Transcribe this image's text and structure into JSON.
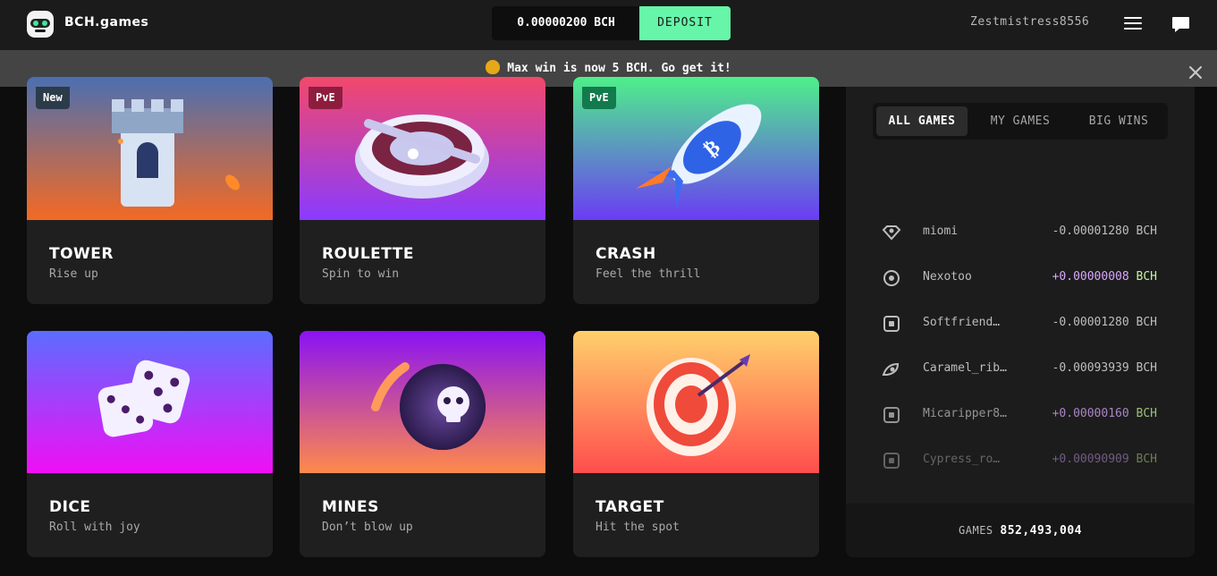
{
  "header": {
    "brand": "BCH.games",
    "balance": "0.00000200 BCH",
    "deposit_label": "DEPOSIT",
    "username": "Zestmistress8556"
  },
  "announcement": {
    "text": "Max win is now 5 BCH. Go get it!"
  },
  "games": [
    {
      "title": "TOWER",
      "subtitle": "Rise up",
      "badge": "New",
      "badge_color": "#2c3b4a",
      "gradient": [
        "#4b6fb0",
        "#f36a24"
      ]
    },
    {
      "title": "ROULETTE",
      "subtitle": "Spin to win",
      "badge": "PvE",
      "badge_color": "#8e1d3d",
      "gradient": [
        "#f3486b",
        "#8a3bff"
      ]
    },
    {
      "title": "CRASH",
      "subtitle": "Feel the thrill",
      "badge": "PvE",
      "badge_color": "#127a4c",
      "gradient": [
        "#4ef08a",
        "#6a3cf5"
      ]
    },
    {
      "title": "DICE",
      "subtitle": "Roll with joy",
      "badge": "",
      "badge_color": "",
      "gradient": [
        "#5b6dff",
        "#f10ef5"
      ]
    },
    {
      "title": "MINES",
      "subtitle": "Don’t blow up",
      "badge": "",
      "badge_color": "",
      "gradient": [
        "#8a12f5",
        "#ff8a4a"
      ]
    },
    {
      "title": "TARGET",
      "subtitle": "Hit the spot",
      "badge": "",
      "badge_color": "",
      "gradient": [
        "#ffd06b",
        "#ff4d4d"
      ]
    }
  ],
  "sidebar": {
    "tabs": [
      "ALL GAMES",
      "MY GAMES",
      "BIG WINS"
    ],
    "active_tab": "ALL GAMES",
    "bets": [
      {
        "icon": "diamond-icon",
        "name": "miomi",
        "amount": "-0.00001280 BCH",
        "win": false
      },
      {
        "icon": "target-icon",
        "name": "Nexotoo",
        "amount": "+0.00000008",
        "unit": " BCH",
        "win": true
      },
      {
        "icon": "dice-icon",
        "name": "Softfriend…",
        "amount": "-0.00001280 BCH",
        "win": false
      },
      {
        "icon": "mines-icon",
        "name": "Caramel_rib…",
        "amount": "-0.00093939 BCH",
        "win": false
      },
      {
        "icon": "dice-icon",
        "name": "Micaripper8…",
        "amount": "+0.00000160",
        "unit": " BCH",
        "win": true
      },
      {
        "icon": "dice-icon",
        "name": "Cypress_ro…",
        "amount": "+0.00090909",
        "unit": " BCH",
        "win": true
      }
    ],
    "footer_label": "GAMES",
    "footer_count": "852,493,004"
  }
}
